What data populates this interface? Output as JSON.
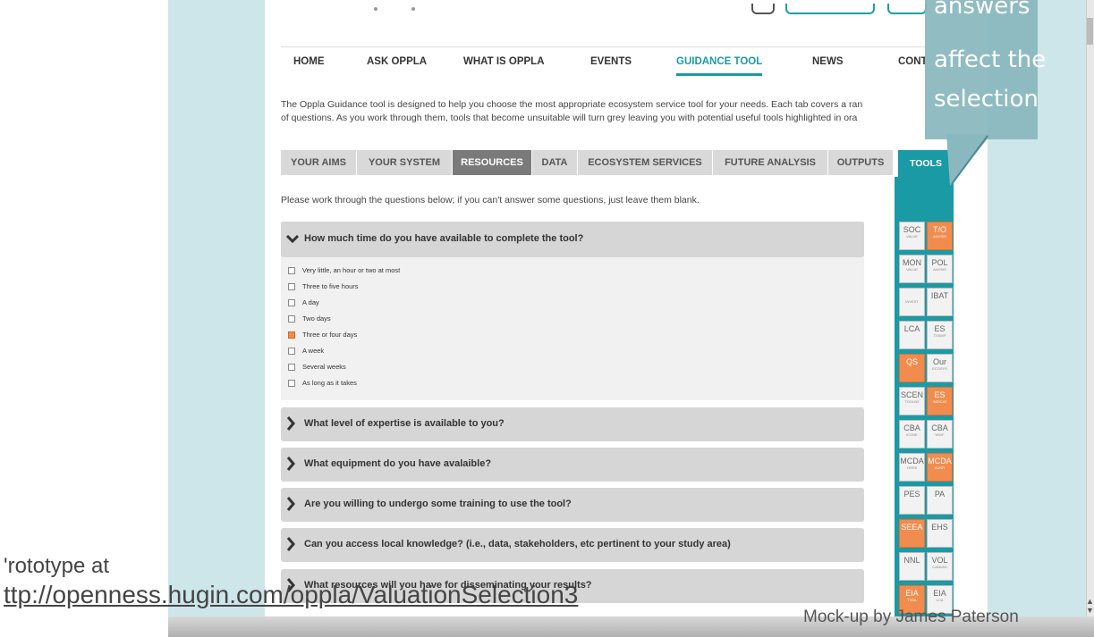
{
  "nav": {
    "items": [
      "HOME",
      "ASK OPPLA",
      "WHAT IS OPPLA",
      "EVENTS",
      "GUIDANCE TOOL",
      "NEWS",
      "CONT"
    ],
    "active": "GUIDANCE TOOL"
  },
  "intro": {
    "line1": "The Oppla Guidance tool is designed to help you choose the most appropriate ecosystem service tool for your needs. Each tab covers a ran",
    "line2": "of questions. As you work through them, tools that become unsuitable will turn grey leaving you with potential useful tools highlighted in ora"
  },
  "tabs": [
    "YOUR AIMS",
    "YOUR SYSTEM",
    "RESOURCES",
    "DATA",
    "ECOSYSTEM SERVICES",
    "FUTURE ANALYSIS",
    "OUTPUTS"
  ],
  "active_tab": "RESOURCES",
  "tools_tab": "TOOLS",
  "instruction": "Please work through the questions below; if you can't answer some questions, just leave them blank.",
  "open_question": {
    "title": "How much time do you have available to complete the tool?",
    "options": [
      {
        "label": "Very little, an hour or two at most",
        "checked": false
      },
      {
        "label": "Three to five hours",
        "checked": false
      },
      {
        "label": "A day",
        "checked": false
      },
      {
        "label": "Two days",
        "checked": false
      },
      {
        "label": "Three or four days",
        "checked": true
      },
      {
        "label": "A week",
        "checked": false
      },
      {
        "label": "Several weeks",
        "checked": false
      },
      {
        "label": "As long as it takes",
        "checked": false
      }
    ]
  },
  "collapsed_questions": [
    "What level of expertise is available to you?",
    "What equipment do you have avalaible?",
    "Are you willing to undergo some training to use the tool?",
    "Can you access local knowledge? (i.e., data, stakeholders, etc pertinent to your study area)",
    "What resources will you have for disseminating your results?"
  ],
  "tools": [
    [
      {
        "name": "SOC",
        "sub": "VALUE",
        "hl": false
      },
      {
        "name": "T/O",
        "sub": "ANYSIS",
        "hl": true
      }
    ],
    [
      {
        "name": "MON",
        "sub": "VALUE",
        "hl": false
      },
      {
        "name": "POL",
        "sub": "ANYSIS",
        "hl": false
      }
    ],
    [
      {
        "name": "",
        "sub": "INVEST",
        "hl": false
      },
      {
        "name": "IBAT",
        "sub": "",
        "hl": false
      }
    ],
    [
      {
        "name": "LCA",
        "sub": "",
        "hl": false
      },
      {
        "name": "ES",
        "sub": "TSSMP",
        "hl": false
      }
    ],
    [
      {
        "name": "QS",
        "sub": "",
        "hl": true
      },
      {
        "name": "Our",
        "sub": "ECOSYS",
        "hl": false
      }
    ],
    [
      {
        "name": "SCEN",
        "sub": "TOOLBX",
        "hl": false
      },
      {
        "name": "ES",
        "sub": "INDICAT",
        "hl": true
      }
    ],
    [
      {
        "name": "CBA",
        "sub": "ICONE",
        "hl": false
      },
      {
        "name": "CBA",
        "sub": "WWF",
        "hl": false
      }
    ],
    [
      {
        "name": "MCDA",
        "sub": "HOSS",
        "hl": false
      },
      {
        "name": "MCDA",
        "sub": "AUNR",
        "hl": true
      }
    ],
    [
      {
        "name": "PES",
        "sub": "",
        "hl": false
      },
      {
        "name": "PA",
        "sub": "",
        "hl": false
      }
    ],
    [
      {
        "name": "SEEA",
        "sub": "",
        "hl": true
      },
      {
        "name": "EHS",
        "sub": "",
        "hl": false
      }
    ],
    [
      {
        "name": "NNL",
        "sub": "",
        "hl": false
      },
      {
        "name": "VOL",
        "sub": "CANVAS",
        "hl": false
      }
    ],
    [
      {
        "name": "EIA",
        "sub": "TSBA",
        "hl": true
      },
      {
        "name": "EIA",
        "sub": "LCA",
        "hl": false
      }
    ]
  ],
  "callout": {
    "line1": "answers",
    "line2": "affect the",
    "line3": "selection"
  },
  "footer": {
    "prototype_label": "'rototype at",
    "prototype_url": "ttp://openness.hugin.com/oppla/ValuationSelection3",
    "mockup_credit": "Mock-up by James Paterson"
  },
  "colors": {
    "accent": "#1a9aa5",
    "highlight": "#f28c4e",
    "panel": "#cde6ea"
  }
}
